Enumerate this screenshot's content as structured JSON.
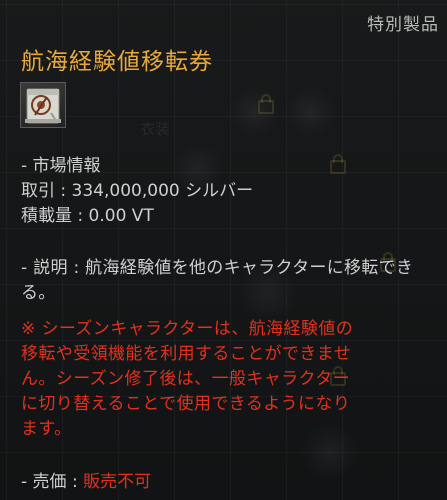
{
  "tooltip": {
    "category": "特別製品",
    "item_name": "航海経験値移転券",
    "icon": "voucher-scroll-icon",
    "market": {
      "header": "- 市場情報",
      "price_label": "取引 : ",
      "price_value": "334,000,000 シルバー",
      "weight_label": "積載量 : ",
      "weight_value": "0.00 VT"
    },
    "description": {
      "text": "- 説明 : 航海経験値を他のキャラクターに移転できる。"
    },
    "warning": {
      "lines": [
        "※ シーズンキャラクターは、航海経験値の",
        "移転や受領機能を利用することができませ",
        "ん。シーズン修了後は、一般キャラクター",
        "に切り替えることで使用できるようになり",
        "ます。"
      ]
    },
    "sell": {
      "label": "- 売価 : ",
      "value": "販売不可"
    }
  },
  "background": {
    "ghost_label": "衣装"
  },
  "colors": {
    "title": "#e8a83e",
    "warning": "#e2321f",
    "text": "#cfcfcf",
    "category": "#b9b9b9"
  }
}
